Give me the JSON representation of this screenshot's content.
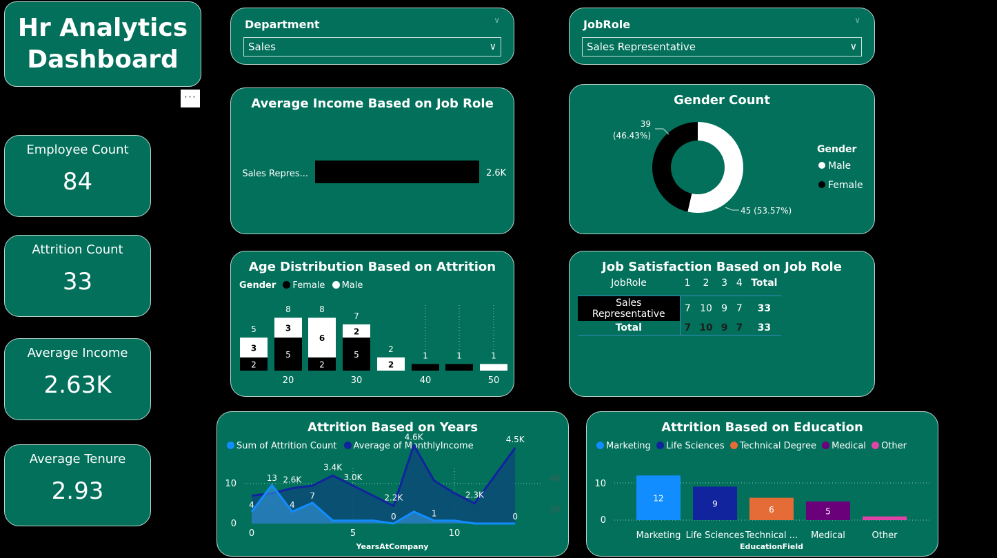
{
  "title": {
    "line1": "Hr Analytics",
    "line2": "Dashboard"
  },
  "more_button": "···",
  "kpis": [
    {
      "label": "Employee Count",
      "value": "84"
    },
    {
      "label": "Attrition Count",
      "value": "33"
    },
    {
      "label": "Average Income",
      "value": "2.63K"
    },
    {
      "label": "Average Tenure",
      "value": "2.93"
    }
  ],
  "slicers": {
    "department": {
      "label": "Department",
      "value": "Sales"
    },
    "jobrole": {
      "label": "JobRole",
      "value": "Sales Representative"
    }
  },
  "income_chart": {
    "title": "Average Income Based on Job Role",
    "category": "Sales Repres...",
    "value_label": "2.6K",
    "value": 2.63
  },
  "gender_chart": {
    "title": "Gender Count",
    "legend_title": "Gender",
    "legend": [
      "Male",
      "Female"
    ],
    "female_label_1": "39",
    "female_label_2": "(46.43%)",
    "male_label": "45 (53.57%)"
  },
  "age_chart": {
    "title": "Age Distribution Based on Attrition",
    "legend_title": "Gender",
    "legend": [
      "Female",
      "Male"
    ],
    "x_ticks": [
      "20",
      "30",
      "40",
      "50"
    ]
  },
  "jobsat_chart": {
    "title": "Job Satisfaction Based on Job Role",
    "headers": [
      "JobRole",
      "1",
      "2",
      "3",
      "4",
      "Total"
    ],
    "row": [
      "Sales Representative",
      "7",
      "10",
      "9",
      "7",
      "33"
    ],
    "total": [
      "Total",
      "7",
      "10",
      "9",
      "7",
      "33"
    ]
  },
  "years_chart": {
    "title": "Attrition Based on Years",
    "legend": [
      "Sum of Attrition Count",
      "Average of MonthlyIncome"
    ],
    "xlabel": "YearsAtCompany",
    "x_ticks": [
      "0",
      "5",
      "10"
    ],
    "y_ticks": [
      "0",
      "10"
    ],
    "y2_ticks": [
      "2K",
      "4K"
    ],
    "attrition_labels": [
      "4",
      "13",
      "4",
      "7",
      "0",
      "1",
      "0"
    ],
    "income_labels": [
      "2.6K",
      "3.4K",
      "3.0K",
      "2.2K",
      "4.6K",
      "2.3K",
      "4.5K"
    ]
  },
  "edu_chart": {
    "title": "Attrition Based on Education",
    "legend": [
      "Marketing",
      "Life Sciences",
      "Technical Degree",
      "Medical",
      "Other"
    ],
    "xlabel": "EducationField",
    "y_ticks": [
      "0",
      "10"
    ],
    "categories": [
      "Marketing",
      "Life Sciences",
      "Technical ...",
      "Medical",
      "Other"
    ],
    "bar_labels": [
      "12",
      "9",
      "6",
      "5",
      ""
    ]
  },
  "chart_data": [
    {
      "type": "bar",
      "title": "Average Income Based on Job Role",
      "categories": [
        "Sales Repres..."
      ],
      "values": [
        2.63
      ]
    },
    {
      "type": "pie",
      "title": "Gender Count",
      "categories": [
        "Male",
        "Female"
      ],
      "values": [
        45,
        39
      ]
    },
    {
      "type": "bar",
      "title": "Age Distribution Based on Attrition",
      "x_ticks": [
        "20",
        "30",
        "40",
        "50"
      ],
      "categories": [
        "18",
        "20",
        "23",
        "30",
        "35",
        "40",
        "45",
        "50"
      ],
      "series": [
        {
          "name": "Female",
          "values": [
            2,
            5,
            2,
            5,
            0,
            1,
            1,
            0
          ]
        },
        {
          "name": "Male",
          "values": [
            3,
            3,
            6,
            2,
            2,
            0,
            0,
            1
          ]
        }
      ],
      "totals": [
        5,
        8,
        8,
        7,
        2,
        1,
        1,
        1
      ]
    },
    {
      "type": "table",
      "title": "Job Satisfaction Based on Job Role",
      "columns": [
        "JobRole",
        "1",
        "2",
        "3",
        "4",
        "Total"
      ],
      "rows": [
        [
          "Sales Representative",
          7,
          10,
          9,
          7,
          33
        ],
        [
          "Total",
          7,
          10,
          9,
          7,
          33
        ]
      ]
    },
    {
      "type": "area",
      "title": "Attrition Based on Years",
      "xlabel": "YearsAtCompany",
      "x": [
        0,
        1,
        2,
        3,
        4,
        5,
        6,
        7,
        8,
        9,
        10,
        11,
        12,
        13
      ],
      "series": [
        {
          "name": "Sum of Attrition Count",
          "values": [
            4,
            13,
            4,
            7,
            1,
            1,
            1,
            0,
            4,
            1,
            1,
            0,
            0,
            0
          ]
        },
        {
          "name": "Average of MonthlyIncome",
          "values": [
            2.6,
            2.7,
            2.9,
            3.0,
            3.4,
            3.0,
            2.6,
            2.2,
            4.6,
            3.2,
            2.7,
            2.3,
            3.4,
            4.5
          ]
        }
      ],
      "ylim": [
        0,
        14
      ],
      "y2lim": [
        1.5,
        4.5
      ]
    },
    {
      "type": "bar",
      "title": "Attrition Based on Education",
      "xlabel": "EducationField",
      "categories": [
        "Marketing",
        "Life Sciences",
        "Technical ...",
        "Medical",
        "Other"
      ],
      "values": [
        12,
        9,
        6,
        5,
        1
      ],
      "ylim": [
        0,
        14
      ]
    }
  ]
}
